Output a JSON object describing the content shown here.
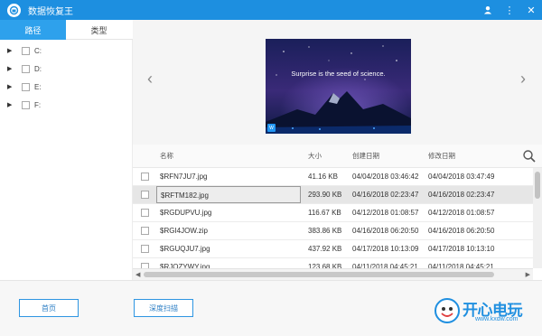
{
  "app": {
    "title": "数据恢复王"
  },
  "window_controls": {
    "user": "👤",
    "menu": "⋮",
    "close": "✕"
  },
  "tabs": [
    {
      "label": "路径",
      "active": true
    },
    {
      "label": "类型",
      "active": false
    }
  ],
  "drives": [
    {
      "label": "C:"
    },
    {
      "label": "D:"
    },
    {
      "label": "E:"
    },
    {
      "label": "F:"
    }
  ],
  "preview": {
    "caption": "Surprise is the seed of science.",
    "badge": "W",
    "prev": "‹",
    "next": "›"
  },
  "table": {
    "headers": {
      "name": "名称",
      "size": "大小",
      "created": "创建日期",
      "modified": "修改日期"
    },
    "rows": [
      {
        "name": "$RFN7JU7.jpg",
        "size": "41.16 KB",
        "created": "04/04/2018 03:46:42",
        "modified": "04/04/2018 03:47:49",
        "selected": false
      },
      {
        "name": "$RFTM182.jpg",
        "size": "293.90 KB",
        "created": "04/16/2018 02:23:47",
        "modified": "04/16/2018 02:23:47",
        "selected": true
      },
      {
        "name": "$RGDUPVU.jpg",
        "size": "116.67 KB",
        "created": "04/12/2018 01:08:57",
        "modified": "04/12/2018 01:08:57",
        "selected": false
      },
      {
        "name": "$RGI4JOW.zip",
        "size": "383.86 KB",
        "created": "04/16/2018 06:20:50",
        "modified": "04/16/2018 06:20:50",
        "selected": false
      },
      {
        "name": "$RGUQJU7.jpg",
        "size": "437.92 KB",
        "created": "04/17/2018 10:13:09",
        "modified": "04/17/2018 10:13:10",
        "selected": false
      },
      {
        "name": "$RJOZYWY.jpg",
        "size": "123.68 KB",
        "created": "04/11/2018 04:45:21",
        "modified": "04/11/2018 04:45:21",
        "selected": false
      }
    ]
  },
  "scroll": {
    "left": "◀",
    "right": "▶"
  },
  "buttons": {
    "home": "首页",
    "deep_scan": "深度扫描"
  },
  "watermark": {
    "text": "开心电玩",
    "url": "www.kxdw.com"
  },
  "colors": {
    "accent": "#1d8fe0",
    "tab_active": "#2ea1ec",
    "selected_row": "#e6e6e6"
  }
}
